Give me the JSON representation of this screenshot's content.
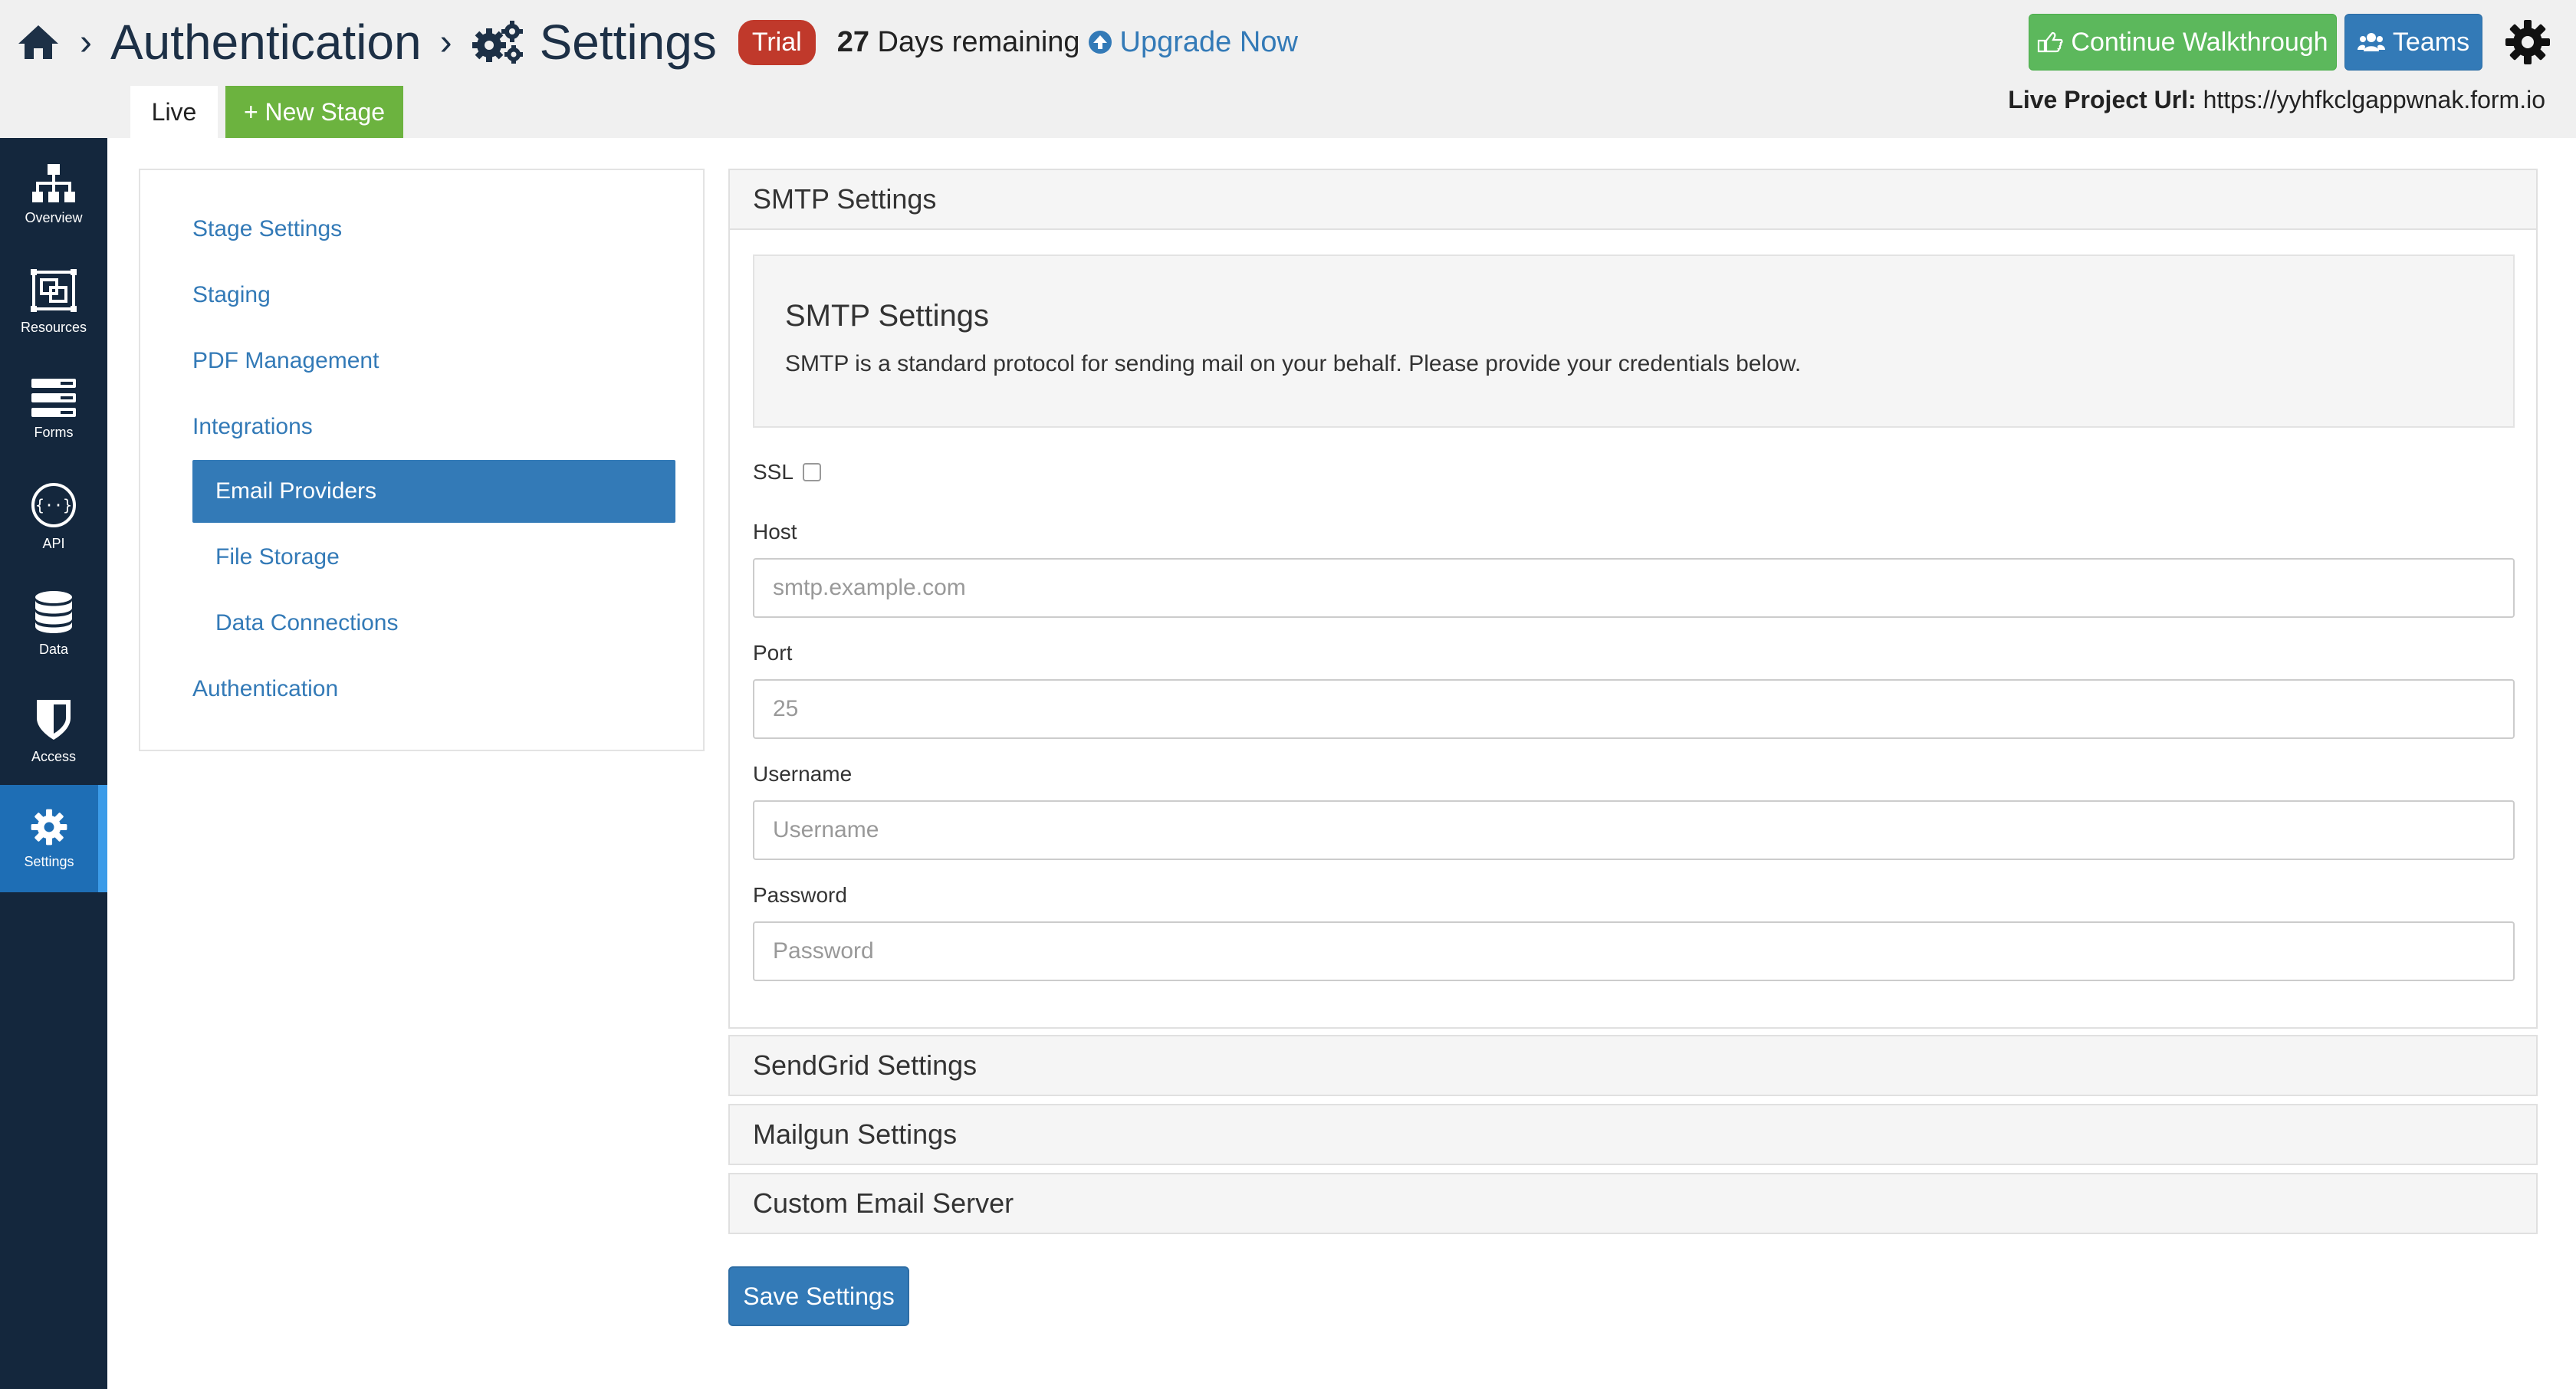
{
  "header": {
    "breadcrumb_1": "Authentication",
    "breadcrumb_2": "Settings",
    "separator": "›",
    "trial_label": "Trial",
    "days_count": "27",
    "days_label": "Days remaining",
    "upgrade_label": "Upgrade Now",
    "walkthrough_label": "Continue Walkthrough",
    "teams_label": "Teams",
    "tab_live": "Live",
    "tab_new_stage": "+ New Stage",
    "live_url_label": "Live Project Url:",
    "live_url_value": "https://yyhfkclgappwnak.form.io"
  },
  "rail": {
    "items": [
      {
        "label": "Overview",
        "icon": "sitemap-icon"
      },
      {
        "label": "Resources",
        "icon": "resources-icon"
      },
      {
        "label": "Forms",
        "icon": "forms-icon"
      },
      {
        "label": "API",
        "icon": "api-icon"
      },
      {
        "label": "Data",
        "icon": "database-icon"
      },
      {
        "label": "Access",
        "icon": "shield-icon"
      },
      {
        "label": "Settings",
        "icon": "gear-icon",
        "active": true
      }
    ]
  },
  "nav": {
    "stage_settings": "Stage Settings",
    "staging": "Staging",
    "pdf_management": "PDF Management",
    "integrations": "Integrations",
    "email_providers": "Email Providers",
    "file_storage": "File Storage",
    "data_connections": "Data Connections",
    "authentication": "Authentication"
  },
  "smtp": {
    "panel_title": "SMTP Settings",
    "well_title": "SMTP Settings",
    "well_desc": "SMTP is a standard protocol for sending mail on your behalf. Please provide your credentials below.",
    "ssl_label": "SSL",
    "host_label": "Host",
    "host_placeholder": "smtp.example.com",
    "port_label": "Port",
    "port_placeholder": "25",
    "username_label": "Username",
    "username_placeholder": "Username",
    "password_label": "Password",
    "password_placeholder": "Password"
  },
  "panels": {
    "sendgrid": "SendGrid Settings",
    "mailgun": "Mailgun Settings",
    "custom": "Custom Email Server"
  },
  "actions": {
    "save_label": "Save Settings"
  },
  "colors": {
    "primary": "#337ab7",
    "success": "#5cb85c",
    "new_stage": "#6cb33f",
    "trial": "#c0392b",
    "rail": "#14273d",
    "rail_active": "#1e6eb5"
  }
}
